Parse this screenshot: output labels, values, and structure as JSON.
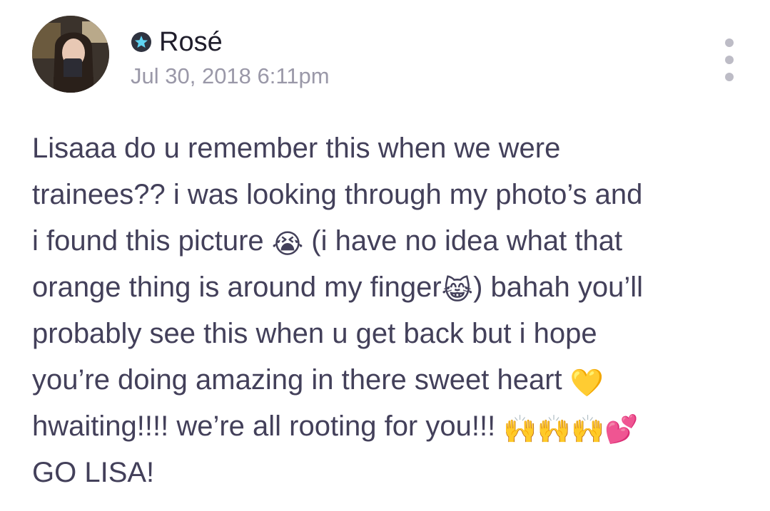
{
  "post": {
    "author_name": "Rosé",
    "timestamp": "Jul 30, 2018 6:11pm",
    "body_lines": [
      {
        "text": "Lisaaa do u remember this when we were"
      },
      {
        "text": "trainees?? i was looking through my photo’s and"
      },
      {
        "before": "i found this picture ",
        "emoji": "😭",
        "after": " (i have no idea what that"
      },
      {
        "before": "orange thing is around my finger",
        "emoji": "😹",
        "after": ") bahah you’ll"
      },
      {
        "text": "probably see this when u get back but i hope"
      },
      {
        "before": "you’re doing amazing in there sweet heart ",
        "emoji": "💛",
        "after": ""
      },
      {
        "before": "hwaiting!!!! we’re all rooting for you!!! ",
        "emoji": "🙌🙌🙌💕",
        "after": ""
      },
      {
        "text": "GO LISA!"
      }
    ]
  },
  "icons": {
    "badge": "star-badge-icon",
    "more": "more-vertical-icon"
  },
  "colors": {
    "text": "#43405a",
    "name": "#1f1d2b",
    "timestamp": "#9a98a8",
    "badge_bg": "#2f3340",
    "badge_star": "#5fd3f2",
    "more_dots": "#bdbcc6"
  }
}
